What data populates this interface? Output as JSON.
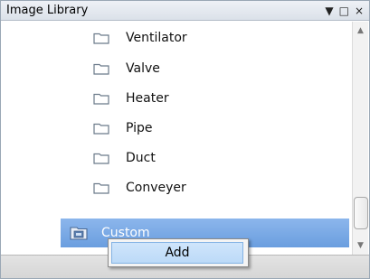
{
  "panel": {
    "title": "Image Library",
    "controls": {
      "dropdown": "▼",
      "maximize": "□",
      "close": "×"
    }
  },
  "tree": {
    "items": [
      {
        "label": "Ventilator",
        "icon": "folder-icon"
      },
      {
        "label": "Valve",
        "icon": "folder-icon"
      },
      {
        "label": "Heater",
        "icon": "folder-icon"
      },
      {
        "label": "Pipe",
        "icon": "folder-icon"
      },
      {
        "label": "Duct",
        "icon": "folder-icon"
      },
      {
        "label": "Conveyer",
        "icon": "folder-icon"
      }
    ],
    "selected": {
      "label": "Custom",
      "icon": "custom-folder-icon"
    }
  },
  "scrollbar": {
    "up": "▲",
    "down": "▼"
  },
  "context_menu": {
    "items": [
      {
        "label": "Add"
      }
    ]
  },
  "colors": {
    "selection": "#7aaae6",
    "menu_highlight": "#c6e0fa"
  }
}
